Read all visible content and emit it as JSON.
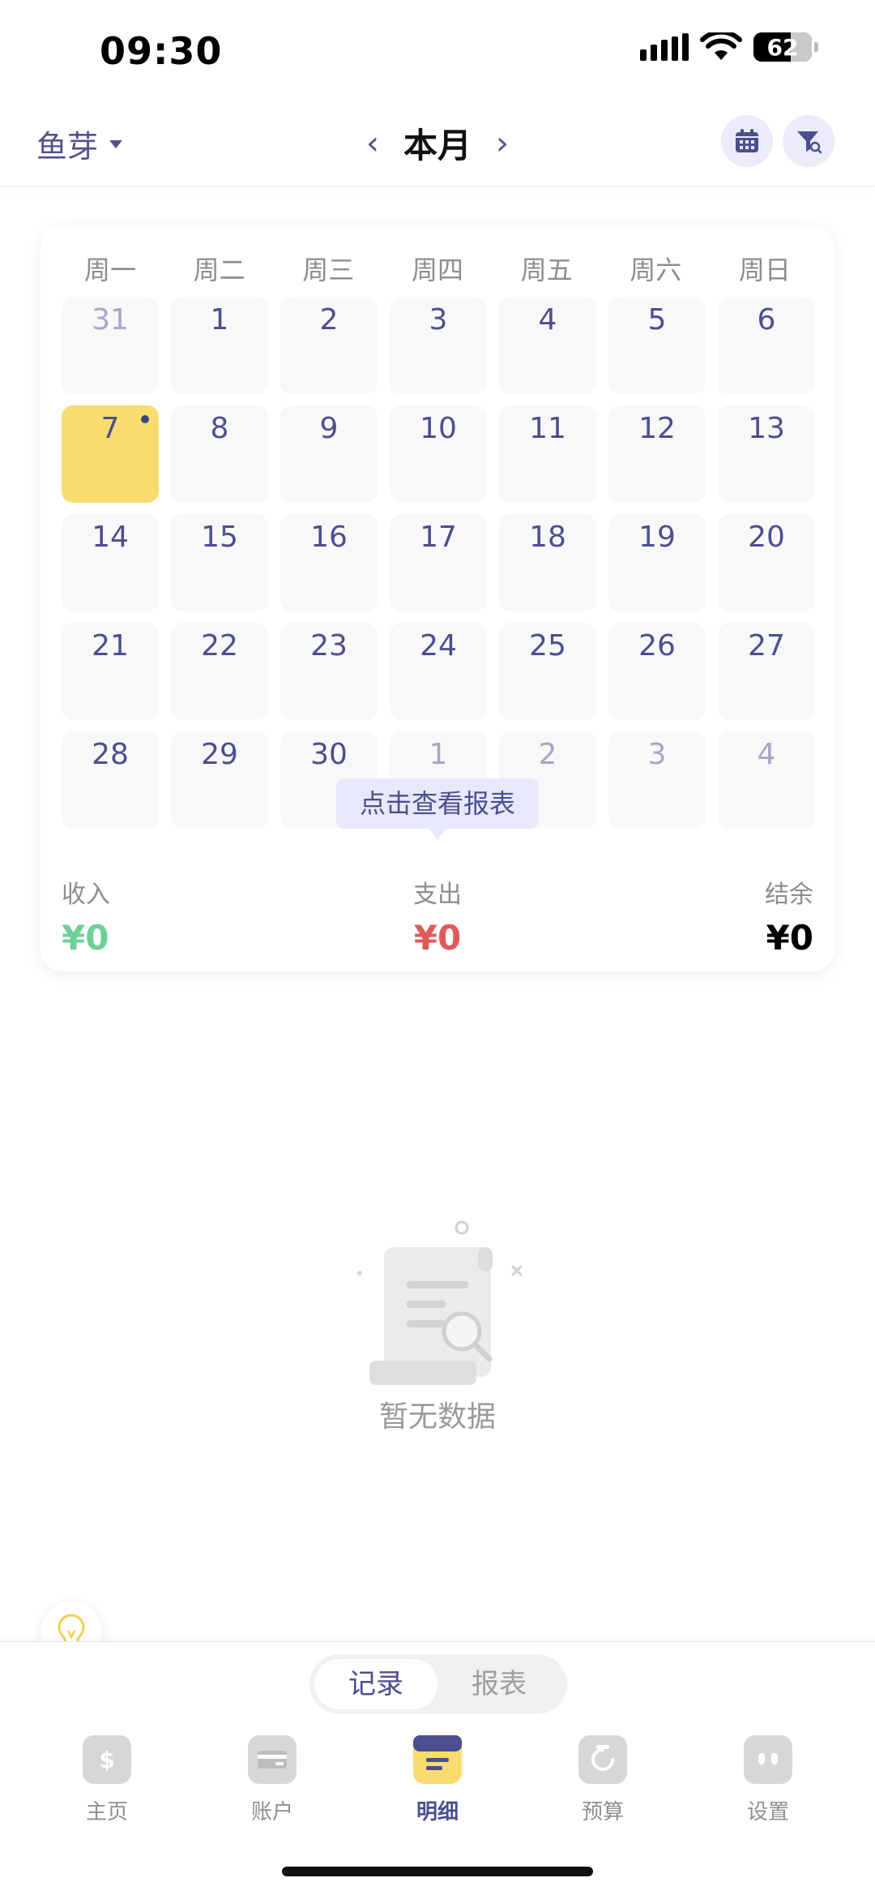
{
  "status": {
    "time": "09:30",
    "battery": "62"
  },
  "header": {
    "book": "鱼芽",
    "month_title": "本月",
    "prev": "‹",
    "next": "›"
  },
  "calendar": {
    "weekdays": [
      "周一",
      "周二",
      "周三",
      "周四",
      "周五",
      "周六",
      "周日"
    ],
    "rows": [
      [
        "31",
        "1",
        "2",
        "3",
        "4",
        "5",
        "6"
      ],
      [
        "7",
        "8",
        "9",
        "10",
        "11",
        "12",
        "13"
      ],
      [
        "14",
        "15",
        "16",
        "17",
        "18",
        "19",
        "20"
      ],
      [
        "21",
        "22",
        "23",
        "24",
        "25",
        "26",
        "27"
      ],
      [
        "28",
        "29",
        "30",
        "1",
        "2",
        "3",
        "4"
      ]
    ],
    "tooltip": "点击查看报表"
  },
  "summary": {
    "income_label": "收入",
    "income_value": "¥0",
    "expense_label": "支出",
    "expense_value": "¥0",
    "balance_label": "结余",
    "balance_value": "¥0"
  },
  "empty": {
    "text": "暂无数据"
  },
  "segment": {
    "record": "记录",
    "report": "报表"
  },
  "tabs": {
    "home": "主页",
    "accounts": "账户",
    "details": "明细",
    "budget": "预算",
    "settings": "设置"
  },
  "colors": {
    "accent": "#4b4f8f",
    "today": "#f8dc6f",
    "income": "#6fcf97",
    "expense": "#e05a5a"
  }
}
